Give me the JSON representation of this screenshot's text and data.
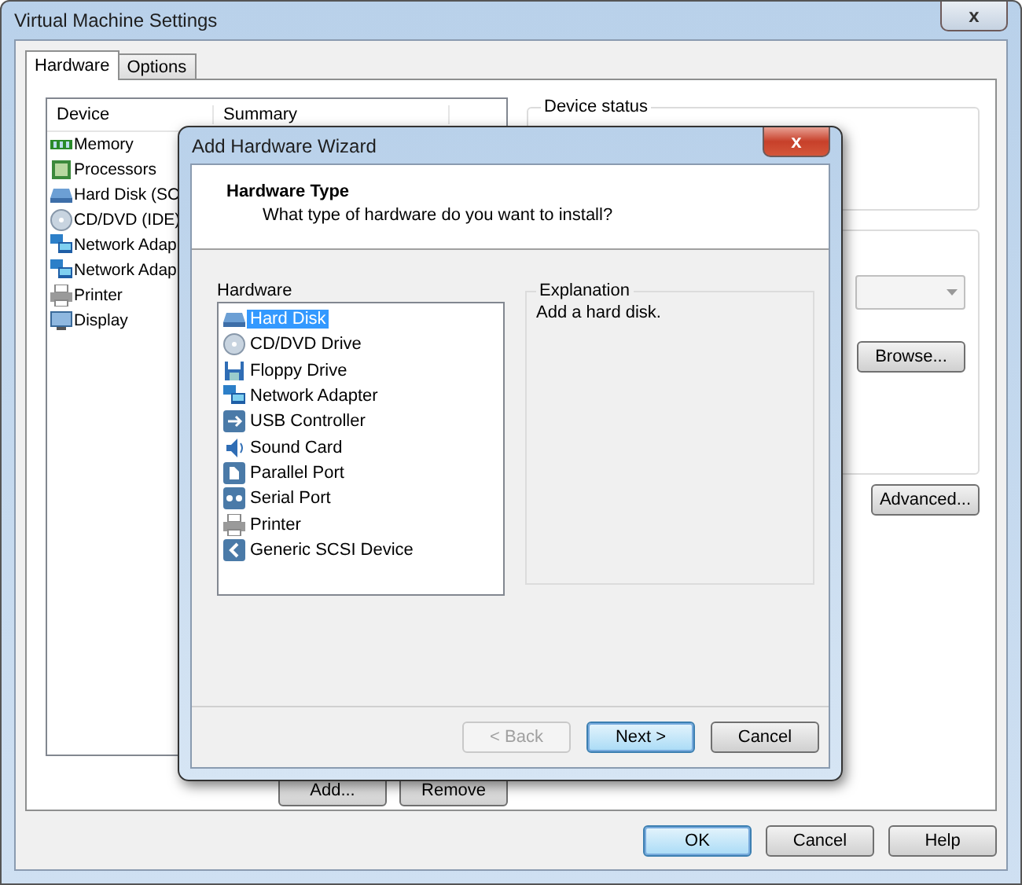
{
  "window": {
    "title": "Virtual Machine Settings",
    "close": "x"
  },
  "tabs": [
    {
      "label": "Hardware",
      "selected": true
    },
    {
      "label": "Options",
      "selected": false
    }
  ],
  "device_table": {
    "columns": [
      "Device",
      "Summary"
    ],
    "rows": [
      {
        "kind": "memory",
        "device": "Memory"
      },
      {
        "kind": "cpu",
        "device": "Processors"
      },
      {
        "kind": "disk",
        "device": "Hard Disk (SC"
      },
      {
        "kind": "cd",
        "device": "CD/DVD (IDE)"
      },
      {
        "kind": "network",
        "device": "Network Adap"
      },
      {
        "kind": "network",
        "device": "Network Adap"
      },
      {
        "kind": "printer",
        "device": "Printer"
      },
      {
        "kind": "display",
        "device": "Display"
      }
    ]
  },
  "device_buttons": [
    "Add...",
    "Remove"
  ],
  "device_status": {
    "label": "Device status"
  },
  "side_buttons": [
    "Browse...",
    "Advanced..."
  ],
  "buttons": [
    {
      "label": "OK",
      "default": true
    },
    {
      "label": "Cancel",
      "default": false
    },
    {
      "label": "Help",
      "default": false
    }
  ],
  "wizard": {
    "title": "Add Hardware Wizard",
    "close": "x",
    "heading": "Hardware Type",
    "subheading": "What type of hardware do you want to install?",
    "list_label": "Hardware",
    "items": [
      {
        "kind": "disk",
        "label": "Hard Disk",
        "selected": true
      },
      {
        "kind": "cd",
        "label": "CD/DVD Drive",
        "selected": false
      },
      {
        "kind": "floppy",
        "label": "Floppy Drive",
        "selected": false
      },
      {
        "kind": "network",
        "label": "Network Adapter",
        "selected": false
      },
      {
        "kind": "usb",
        "label": "USB Controller",
        "selected": false
      },
      {
        "kind": "sound",
        "label": "Sound Card",
        "selected": false
      },
      {
        "kind": "parallel",
        "label": "Parallel Port",
        "selected": false
      },
      {
        "kind": "serial",
        "label": "Serial Port",
        "selected": false
      },
      {
        "kind": "printer",
        "label": "Printer",
        "selected": false
      },
      {
        "kind": "scsi",
        "label": "Generic SCSI Device",
        "selected": false
      }
    ],
    "explanation_label": "Explanation",
    "explanation": "Add a hard disk.",
    "buttons": [
      {
        "label": "< Back",
        "disabled": true,
        "default": false
      },
      {
        "label": "Next >",
        "disabled": false,
        "default": true
      },
      {
        "label": "Cancel",
        "disabled": false,
        "default": false
      }
    ]
  }
}
